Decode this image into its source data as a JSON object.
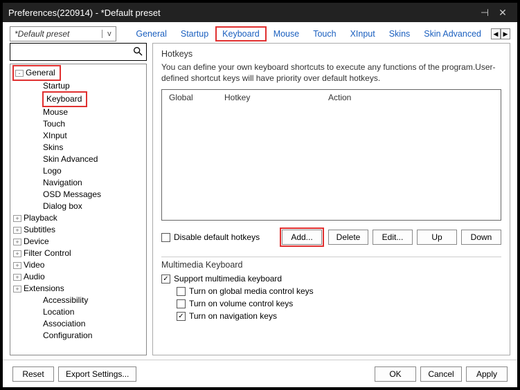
{
  "window": {
    "title": "Preferences(220914) - *Default preset"
  },
  "preset": {
    "value": "*Default preset"
  },
  "tabs": {
    "items": [
      "General",
      "Startup",
      "Keyboard",
      "Mouse",
      "Touch",
      "XInput",
      "Skins",
      "Skin Advanced"
    ],
    "active_index": 2
  },
  "search": {
    "placeholder": ""
  },
  "tree": {
    "items": [
      {
        "label": "General",
        "level": 0,
        "expander": "-",
        "highlight": true
      },
      {
        "label": "Startup",
        "level": 1
      },
      {
        "label": "Keyboard",
        "level": 1,
        "highlight": true
      },
      {
        "label": "Mouse",
        "level": 1
      },
      {
        "label": "Touch",
        "level": 1
      },
      {
        "label": "XInput",
        "level": 1
      },
      {
        "label": "Skins",
        "level": 1
      },
      {
        "label": "Skin Advanced",
        "level": 1
      },
      {
        "label": "Logo",
        "level": 1
      },
      {
        "label": "Navigation",
        "level": 1
      },
      {
        "label": "OSD Messages",
        "level": 1
      },
      {
        "label": "Dialog box",
        "level": 1
      },
      {
        "label": "Playback",
        "level": 0,
        "expander": "+"
      },
      {
        "label": "Subtitles",
        "level": 0,
        "expander": "+"
      },
      {
        "label": "Device",
        "level": 0,
        "expander": "+"
      },
      {
        "label": "Filter Control",
        "level": 0,
        "expander": "+"
      },
      {
        "label": "Video",
        "level": 0,
        "expander": "+"
      },
      {
        "label": "Audio",
        "level": 0,
        "expander": "+"
      },
      {
        "label": "Extensions",
        "level": 0,
        "expander": "+"
      },
      {
        "label": "Accessibility",
        "level": 1
      },
      {
        "label": "Location",
        "level": 1
      },
      {
        "label": "Association",
        "level": 1
      },
      {
        "label": "Configuration",
        "level": 1
      }
    ]
  },
  "hotkeys": {
    "group_title": "Hotkeys",
    "description": "You can define your own keyboard shortcuts to execute any functions of the program.User-defined shortcut keys will have priority over default hotkeys.",
    "columns": [
      "Global",
      "Hotkey",
      "Action"
    ],
    "disable_label": "Disable default hotkeys",
    "disable_checked": false,
    "buttons": {
      "add": "Add...",
      "delete": "Delete",
      "edit": "Edit...",
      "up": "Up",
      "down": "Down"
    }
  },
  "multimedia": {
    "group_title": "Multimedia Keyboard",
    "support": {
      "label": "Support multimedia keyboard",
      "checked": true
    },
    "opts": [
      {
        "label": "Turn on global media control keys",
        "checked": false
      },
      {
        "label": "Turn on volume control keys",
        "checked": false
      },
      {
        "label": "Turn on navigation keys",
        "checked": true
      }
    ]
  },
  "footer": {
    "reset": "Reset",
    "export": "Export Settings...",
    "ok": "OK",
    "cancel": "Cancel",
    "apply": "Apply"
  }
}
